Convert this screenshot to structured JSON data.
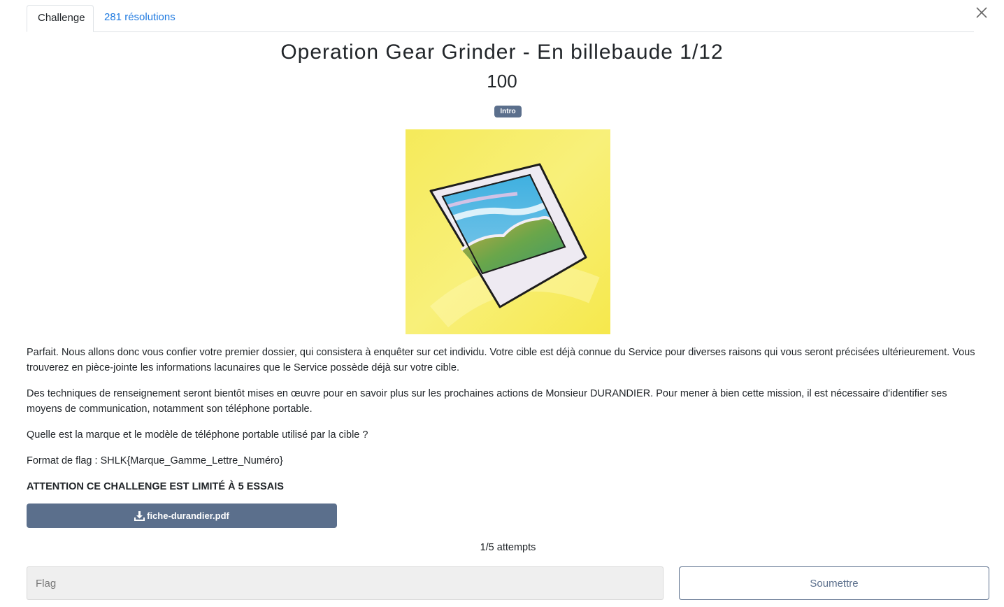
{
  "tabs": [
    {
      "label": "Challenge",
      "active": true
    },
    {
      "label": "281 résolutions",
      "active": false
    }
  ],
  "close_icon": "close-icon",
  "challenge": {
    "title": "Operation Gear Grinder - En billebaude 1/12",
    "points": "100",
    "tag": "Intro"
  },
  "description": {
    "p1": "Parfait. Nous allons donc vous confier votre premier dossier, qui consistera à enquêter sur cet individu. Votre cible est déjà connue du Service pour diverses raisons qui vous seront précisées ultérieurement. Vous trouverez en pièce-jointe les informations lacunaires que le Service possède déjà sur votre cible.",
    "p2": "Des techniques de renseignement seront bientôt mises en œuvre pour en savoir plus sur les prochaines actions de Monsieur DURANDIER. Pour mener à bien cette mission, il est nécessaire d'identifier ses moyens de communication, notamment son téléphone portable.",
    "p3": "Quelle est la marque et le modèle de téléphone portable utilisé par la cible ?",
    "p4": "Format de flag : SHLK{Marque_Gamme_Lettre_Numéro}",
    "p5": "ATTENTION CE CHALLENGE EST LIMITÉ À 5 ESSAIS"
  },
  "attachment": {
    "label": "fiche-durandier.pdf",
    "icon": "download-icon"
  },
  "attempts": "1/5 attempts",
  "flag": {
    "placeholder": "Flag",
    "value": ""
  },
  "submit_label": "Soumettre",
  "colors": {
    "accent": "#5b6f8c",
    "link": "#1f7ae0"
  }
}
